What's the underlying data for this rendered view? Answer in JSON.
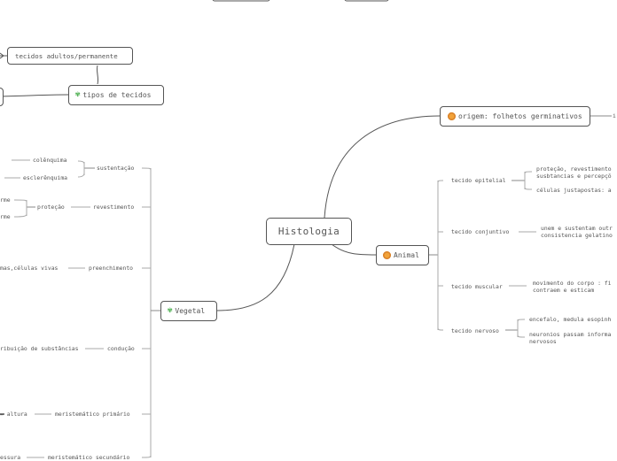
{
  "root": {
    "label": "Histologia"
  },
  "icons": {
    "vegetal": "leaf-icon",
    "animal": "animal-face-icon",
    "tipos": "leaf-icon",
    "origem": "animal-face-icon"
  },
  "colors": {
    "line": "#555555",
    "leaf_icon": "#4caf50",
    "animal_icon": "#f2a33a"
  },
  "nodes": {
    "tecidos_adultos": "tecidos adultos/permanente",
    "tipos_de_tecidos": "tipos de tecidos",
    "origem": "origem: folhetos germinativos",
    "origem_child": "i",
    "animal": "Animal",
    "vegetal": "Vegetal"
  },
  "animal": {
    "epitelial": {
      "label": "tecido epitelial",
      "details": [
        "proteção, revestimento",
        "susbtancias e percepçõ",
        "células justapostas: a"
      ]
    },
    "conjuntivo": {
      "label": "tecido conjuntivo",
      "details": [
        "unem e sustentam outr",
        "consistencia gelatino"
      ]
    },
    "muscular": {
      "label": "tecido muscular",
      "details": [
        "movimento do corpo : fi",
        "contraem e esticam"
      ]
    },
    "nervoso": {
      "label": "tecido nervoso",
      "details": [
        "encefalo, medula esopinh",
        "neuronios passam informa",
        "nervosos"
      ]
    }
  },
  "vegetal": {
    "sustentacao": {
      "label": "sustentação",
      "children": [
        "colênquima",
        "esclerênquima"
      ]
    },
    "revestimento": {
      "label": "revestimento",
      "child": "proteção",
      "leaves": [
        "rme",
        "rme"
      ]
    },
    "preenchimento": {
      "label": "preenchimento",
      "child": "mas,células vivas"
    },
    "conducao": {
      "label": "condução",
      "child": "ribuição de substâncias"
    },
    "meristematico_primario": {
      "label": "meristemático primário",
      "child": "= altura"
    },
    "meristematico_secundario": {
      "label": "meristemático secundário",
      "child": "essura"
    }
  }
}
